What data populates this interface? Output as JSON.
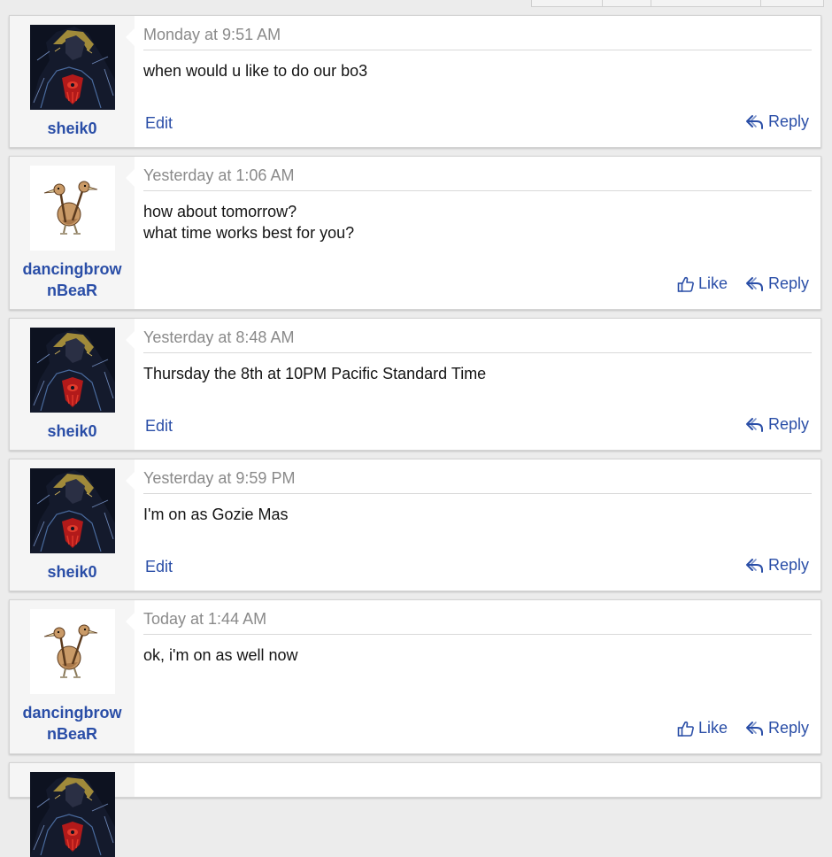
{
  "labels": {
    "edit": "Edit",
    "reply": "Reply",
    "like": "Like"
  },
  "icons": {
    "like": "thumbs-up-icon",
    "reply": "reply-arrow-icon"
  },
  "colors": {
    "link": "#2a4ea7",
    "date": "#8a8a8a",
    "background": "#ececec"
  },
  "messages": [
    {
      "author": "sheik0",
      "date": "Monday at 9:51 AM",
      "lines": [
        "when would u like to do our bo3"
      ],
      "avatar": "sheik-avatar",
      "own": true
    },
    {
      "author": "dancingbrownBeaR",
      "author_lines": [
        "dancingbrow",
        "nBeaR"
      ],
      "date": "Yesterday at 1:06 AM",
      "lines": [
        "how about tomorrow?",
        "what time works best for you?"
      ],
      "avatar": "doduo-avatar",
      "own": false
    },
    {
      "author": "sheik0",
      "date": "Yesterday at 8:48 AM",
      "lines": [
        "Thursday the 8th at 10PM Pacific Standard Time"
      ],
      "avatar": "sheik-avatar",
      "own": true
    },
    {
      "author": "sheik0",
      "date": "Yesterday at 9:59 PM",
      "lines": [
        "I'm on as Gozie Mas"
      ],
      "avatar": "sheik-avatar",
      "own": true
    },
    {
      "author": "dancingbrownBeaR",
      "author_lines": [
        "dancingbrow",
        "nBeaR"
      ],
      "date": "Today at 1:44 AM",
      "lines": [
        "ok, i'm on as well now"
      ],
      "avatar": "doduo-avatar",
      "own": false
    }
  ]
}
